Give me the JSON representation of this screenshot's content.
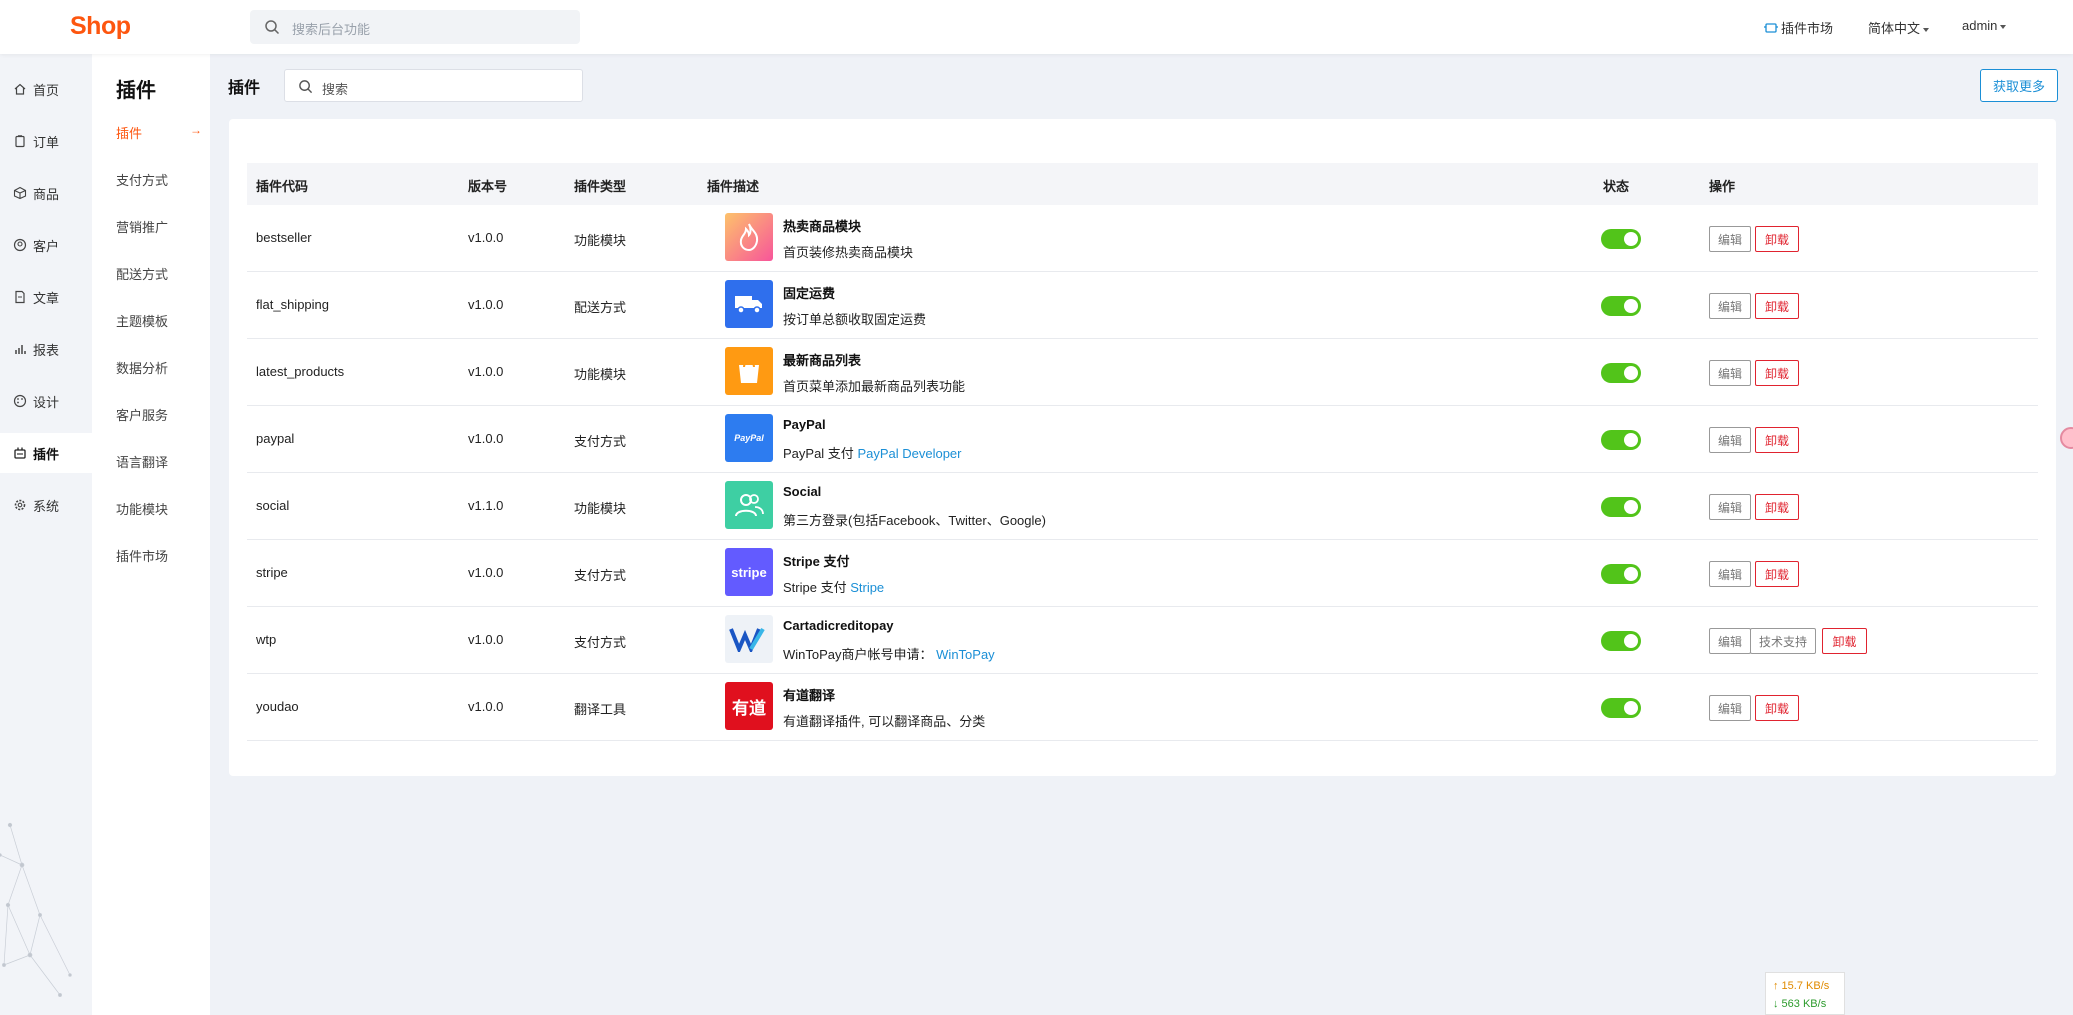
{
  "header": {
    "logo": "Shop",
    "search_placeholder": "搜索后台功能",
    "plugin_market": "插件市场",
    "language": "简体中文",
    "user": "admin"
  },
  "nav_primary": [
    {
      "label": "首页",
      "icon": "home-icon"
    },
    {
      "label": "订单",
      "icon": "clipboard-icon"
    },
    {
      "label": "商品",
      "icon": "box-icon"
    },
    {
      "label": "客户",
      "icon": "user-icon"
    },
    {
      "label": "文章",
      "icon": "document-icon"
    },
    {
      "label": "报表",
      "icon": "bar-chart-icon"
    },
    {
      "label": "设计",
      "icon": "palette-icon"
    },
    {
      "label": "插件",
      "icon": "plugin-icon",
      "active": true
    },
    {
      "label": "系统",
      "icon": "gear-icon"
    }
  ],
  "nav_secondary": {
    "title": "插件",
    "items": [
      "插件",
      "支付方式",
      "营销推广",
      "配送方式",
      "主题模板",
      "数据分析",
      "客户服务",
      "语言翻译",
      "功能模块",
      "插件市场"
    ]
  },
  "main": {
    "title": "插件",
    "search_placeholder": "搜索",
    "more_button": "获取更多"
  },
  "table": {
    "columns": [
      "插件代码",
      "版本号",
      "插件类型",
      "插件描述",
      "状态",
      "操作"
    ],
    "rows": [
      {
        "code": "bestseller",
        "version": "v1.0.0",
        "type": "功能模块",
        "name": "热卖商品模块",
        "desc": "首页装修热卖商品模块",
        "link": "",
        "enabled": true,
        "actions": [
          "编辑",
          "卸载"
        ],
        "icon": "fire-icon"
      },
      {
        "code": "flat_shipping",
        "version": "v1.0.0",
        "type": "配送方式",
        "name": "固定运费",
        "desc": "按订单总额收取固定运费",
        "link": "",
        "enabled": true,
        "actions": [
          "编辑",
          "卸载"
        ],
        "icon": "truck-icon"
      },
      {
        "code": "latest_products",
        "version": "v1.0.0",
        "type": "功能模块",
        "name": "最新商品列表",
        "desc": "首页菜单添加最新商品列表功能",
        "link": "",
        "enabled": true,
        "actions": [
          "编辑",
          "卸载"
        ],
        "icon": "shopping-bag-icon"
      },
      {
        "code": "paypal",
        "version": "v1.0.0",
        "type": "支付方式",
        "name": "PayPal",
        "desc": "PayPal 支付",
        "link": "PayPal Developer",
        "enabled": true,
        "actions": [
          "编辑",
          "卸载"
        ],
        "icon": "paypal-logo-icon"
      },
      {
        "code": "social",
        "version": "v1.1.0",
        "type": "功能模块",
        "name": "Social",
        "desc": "第三方登录(包括Facebook、Twitter、Google)",
        "link": "",
        "enabled": true,
        "actions": [
          "编辑",
          "卸载"
        ],
        "icon": "users-icon"
      },
      {
        "code": "stripe",
        "version": "v1.0.0",
        "type": "支付方式",
        "name": "Stripe 支付",
        "desc": "Stripe 支付",
        "link": "Stripe",
        "enabled": true,
        "actions": [
          "编辑",
          "卸载"
        ],
        "icon": "stripe-logo-icon"
      },
      {
        "code": "wtp",
        "version": "v1.0.0",
        "type": "支付方式",
        "name": "Cartadicreditopay",
        "desc": "WinToPay商户帐号申请：",
        "link": "WinToPay",
        "enabled": true,
        "actions": [
          "编辑",
          "技术支持",
          "卸载"
        ],
        "icon": "wintopay-logo-icon"
      },
      {
        "code": "youdao",
        "version": "v1.0.0",
        "type": "翻译工具",
        "name": "有道翻译",
        "desc": "有道翻译插件, 可以翻译商品、分类",
        "link": "",
        "enabled": true,
        "actions": [
          "编辑",
          "卸载"
        ],
        "icon": "youdao-logo-icon"
      }
    ]
  },
  "logo_text": {
    "paypal": "PayPal",
    "stripe": "stripe",
    "youdao": "有道"
  },
  "network": {
    "up": "↑ 15.7 KB/s",
    "down": "↓ 563 KB/s"
  },
  "colors": {
    "brand": "#fd560f",
    "link": "#1b8fd6",
    "toggle_on": "#52c41a",
    "danger": "#e0232f"
  }
}
